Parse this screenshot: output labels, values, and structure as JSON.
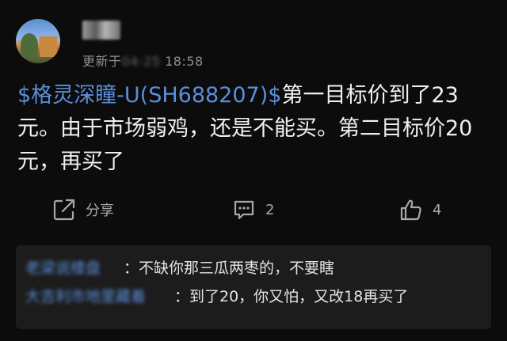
{
  "post": {
    "author_name": "",
    "updated_prefix": "更新于",
    "updated_blurred": "04-25",
    "updated_time": "18:58",
    "content": {
      "stock_tag": "$格灵深瞳-U(SH688207)$",
      "text": "第一目标价到了23元。由于市场弱鸡，还是不能买。第二目标价20元，再买了"
    },
    "actions": {
      "share_label": "分享",
      "comment_count": "2",
      "like_count": "4"
    }
  },
  "replies": [
    {
      "nick": "老梁说楼盘",
      "text": "：不缺你那三瓜两枣的，不要瞎"
    },
    {
      "nick": "大吉利市地里藏着",
      "text": "：到了20，你又怕，又改18再买了"
    }
  ],
  "colors": {
    "background": "#0c0c0c",
    "link_blue": "#5b8fdb",
    "reply_panel": "#1c1c1c"
  }
}
